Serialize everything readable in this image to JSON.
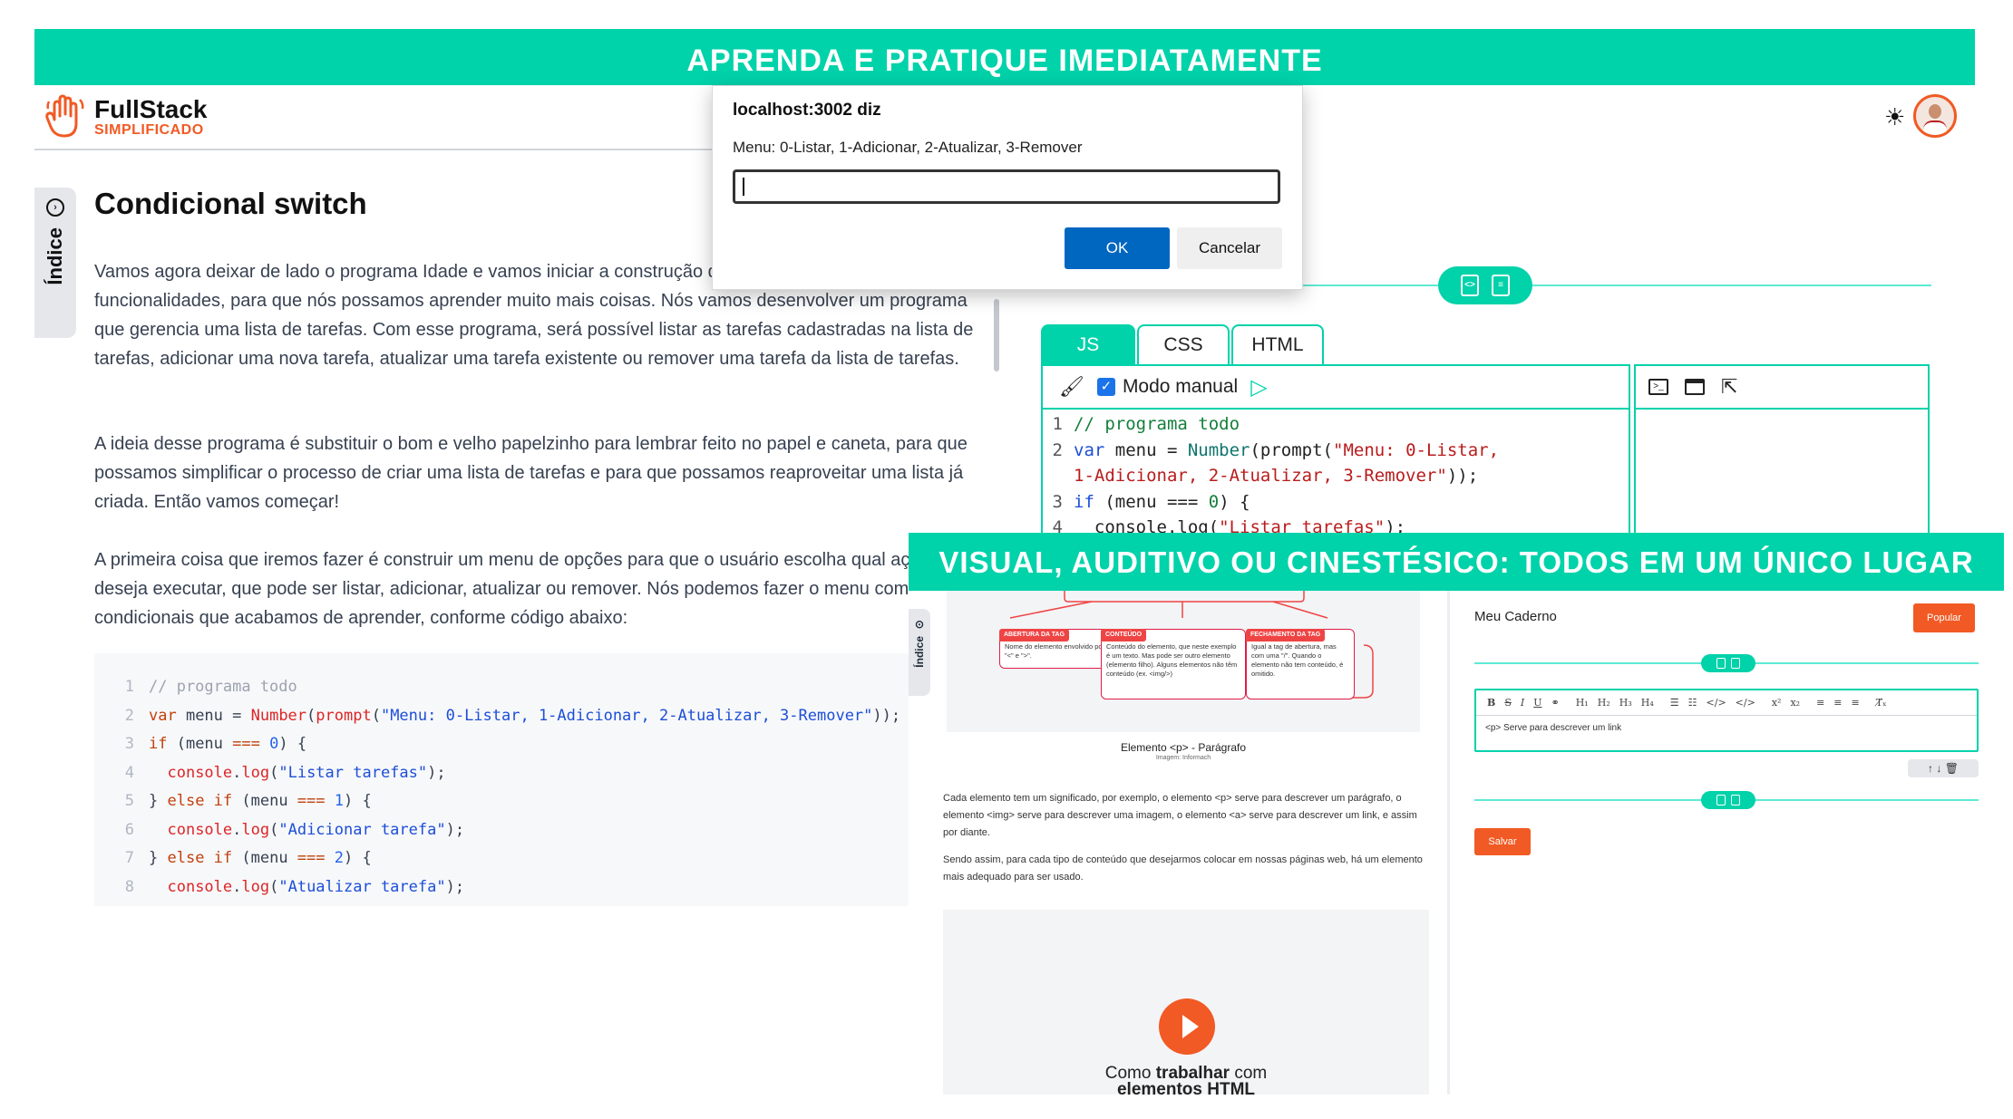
{
  "banners": {
    "top": "APRENDA E PRATIQUE IMEDIATAMENTE",
    "bottom": "VISUAL, AUDITIVO OU CINESTÉSICO: TODOS EM UM ÚNICO LUGAR"
  },
  "brand": {
    "name": "FullStack",
    "tagline": "SIMPLIFICADO",
    "accent": "#f15a24",
    "teal": "#00d2aa"
  },
  "header": {
    "theme_icon": "sun-icon",
    "avatar": "user-avatar"
  },
  "sidebar": {
    "indice_label": "Índice"
  },
  "article": {
    "title": "Condicional switch",
    "paragraphs": [
      "Vamos agora deixar de lado o programa Idade e vamos iniciar a construção de um programa com mais funcionalidades, para que nós possamos aprender muito mais coisas. Nós vamos desenvolver um programa que gerencia uma lista de tarefas. Com esse programa, será possível listar as tarefas cadastradas na lista de tarefas, adicionar uma nova tarefa, atualizar uma tarefa existente ou remover uma tarefa da lista de tarefas.",
      "A ideia desse programa é substituir o bom e velho papelzinho para lembrar feito no papel e caneta, para que possamos simplificar o processo de criar uma lista de tarefas e para que possamos reaproveitar uma lista já criada. Então vamos começar!",
      "A primeira coisa que iremos fazer é construir um menu de opções para que o usuário escolha qual ação ele deseja executar, que pode ser listar, adicionar, atualizar ou remover. Nós podemos fazer o menu com as condicionais que acabamos de aprender, conforme código abaixo:"
    ]
  },
  "dialog": {
    "title": "localhost:3002 diz",
    "message": "Menu: 0-Listar, 1-Adicionar, 2-Atualizar, 3-Remover",
    "input_value": "",
    "ok_label": "OK",
    "cancel_label": "Cancelar"
  },
  "editor": {
    "tabs": [
      "JS",
      "CSS",
      "HTML"
    ],
    "active_tab": "JS",
    "mode_label": "Modo manual",
    "mode_checked": true
  },
  "lower": {
    "indice_label": "Índice",
    "diagram": {
      "boxes": [
        {
          "tag": "ABERTURA DA TAG",
          "text": "Nome do elemento envolvido por \"<\" e \">\"."
        },
        {
          "tag": "CONTEÚDO",
          "text": "Conteúdo do elemento, que neste exemplo é um texto. Mas pode ser outro elemento (elemento filho). Alguns elementos não têm conteúdo (ex. <img/>)"
        },
        {
          "tag": "FECHAMENTO DA TAG",
          "text": "Igual a tag de abertura, mas com uma \"/\". Quando o elemento não tem conteúdo, é omitido."
        }
      ],
      "caption": "Elemento <p> - Parágrafo",
      "credit": "Imagem: Informach"
    },
    "paragraphs": [
      "Cada elemento tem um significado, por exemplo, o elemento <p> serve para descrever um parágrafo, o elemento <img> serve para descrever uma imagem, o elemento <a> serve para descrever um link, e assim por diante.",
      "Sendo assim, para cada tipo de conteúdo que desejarmos colocar em nossas páginas web, há um elemento mais adequado para ser usado."
    ],
    "video": {
      "line1_pre": "Como ",
      "line1_bold": "trabalhar",
      "line1_post": " com",
      "line2": "elementos HTML"
    },
    "notebook": {
      "title": "Meu Caderno",
      "popular_label": "Popular",
      "toolbar": [
        "B",
        "S",
        "I",
        "U",
        "🔗",
        "H1",
        "H2",
        "H3",
        "H4",
        "☰",
        "☷",
        "</>",
        "</>",
        "x²",
        "x₂",
        "≡",
        "≡",
        "≡",
        "Tx"
      ],
      "content": "<p> Serve para descrever um link",
      "save_label": "Salvar"
    }
  }
}
